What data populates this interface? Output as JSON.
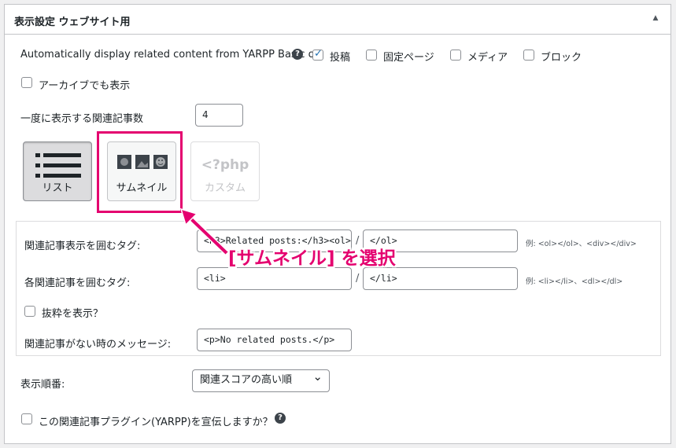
{
  "panel": {
    "title": "表示設定 ウェブサイト用",
    "toggle_icon": "▲"
  },
  "auto_display": {
    "label": "Automatically display related content from YARPP Basic on:",
    "help_icon": "?",
    "options": [
      {
        "label": "投稿",
        "checked": true
      },
      {
        "label": "固定ページ",
        "checked": false
      },
      {
        "label": "メディア",
        "checked": false
      },
      {
        "label": "ブロック",
        "checked": false
      }
    ]
  },
  "archive": {
    "label": "アーカイブでも表示",
    "checked": false
  },
  "count": {
    "label": "一度に表示する関連記事数",
    "value": "4"
  },
  "templates": {
    "list": {
      "label": "リスト",
      "state": "active"
    },
    "thumbnail": {
      "label": "サムネイル",
      "state": "normal"
    },
    "custom": {
      "label": "カスタム",
      "icon_text": "<?php",
      "state": "disabled"
    }
  },
  "sub": {
    "wrap_tag": {
      "label": "関連記事表示を囲むタグ:",
      "before": "<h3>Related posts:</h3><ol>",
      "after": "</ol>",
      "hint": "例: <ol></ol>、<div></div>"
    },
    "item_tag": {
      "label": "各関連記事を囲むタグ:",
      "before": "<li>",
      "after": "</li>",
      "hint": "例: <li></li>、<dl></dl>"
    },
    "excerpt": {
      "label": "抜粋を表示？",
      "checked": false
    },
    "no_results": {
      "label": "関連記事がない時のメッセージ:",
      "value": "<p>No related posts.</p>"
    },
    "separator": "/"
  },
  "order": {
    "label": "表示順番:",
    "selected": "関連スコアの高い順",
    "chevron": "⌄"
  },
  "promote": {
    "label": "この関連記事プラグイン(YARPP)を宣伝しますか？",
    "help_icon": "?",
    "checked": false
  },
  "annotation": {
    "text": "[サムネイル] を選択",
    "color": "#e4006f"
  }
}
